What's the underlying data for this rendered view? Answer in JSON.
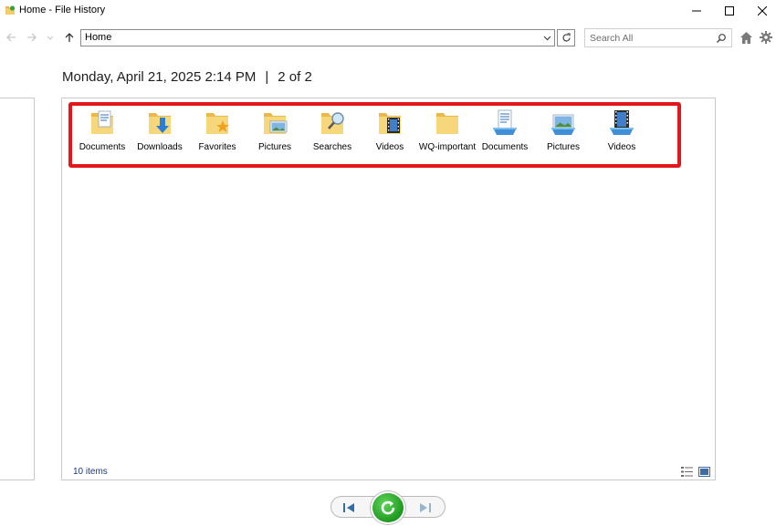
{
  "window": {
    "title": "Home - File History"
  },
  "toolbar": {
    "address_value": "Home",
    "search_placeholder": "Search All"
  },
  "header": {
    "date": "Monday, April 21, 2025 2:14 PM",
    "separator": "|",
    "position": "2 of 2"
  },
  "items": [
    {
      "label": "Documents",
      "icon": "documents-folder-icon"
    },
    {
      "label": "Downloads",
      "icon": "downloads-folder-icon"
    },
    {
      "label": "Favorites",
      "icon": "favorites-folder-icon"
    },
    {
      "label": "Pictures",
      "icon": "pictures-folder-icon"
    },
    {
      "label": "Searches",
      "icon": "searches-folder-icon"
    },
    {
      "label": "Videos",
      "icon": "videos-folder-icon"
    },
    {
      "label": "WQ-important",
      "icon": "plain-folder-icon"
    },
    {
      "label": "Documents",
      "icon": "documents-library-icon"
    },
    {
      "label": "Pictures",
      "icon": "pictures-library-icon"
    },
    {
      "label": "Videos",
      "icon": "videos-library-icon"
    }
  ],
  "status": {
    "count": "10 items"
  },
  "colors": {
    "highlight": "#e3161b",
    "folder": "#f3cd6a",
    "restore_green": "#1d9a1f"
  }
}
